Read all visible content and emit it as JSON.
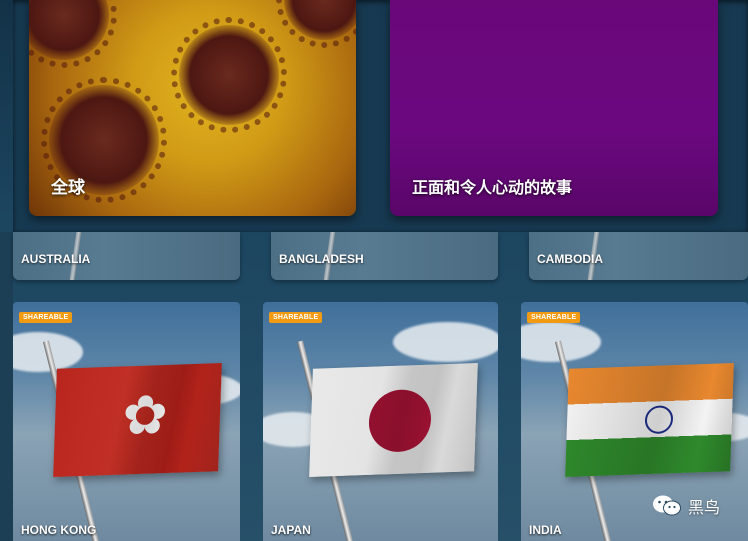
{
  "top_tiles": [
    {
      "label": "全球"
    },
    {
      "label": "正面和令人心动的故事"
    }
  ],
  "countries_row": [
    {
      "label": "AUSTRALIA"
    },
    {
      "label": "BANGLADESH"
    },
    {
      "label": "CAMBODIA"
    }
  ],
  "flag_tiles": [
    {
      "badge": "SHAREABLE",
      "label": "HONG KONG",
      "flag_icon": "hong-kong-flag"
    },
    {
      "badge": "SHAREABLE",
      "label": "JAPAN",
      "flag_icon": "japan-flag"
    },
    {
      "badge": "SHAREABLE",
      "label": "INDIA",
      "flag_icon": "india-flag"
    }
  ],
  "watermark": {
    "text": "黑鸟",
    "icon": "wechat-icon"
  },
  "colors": {
    "badge": "#f19a12",
    "stories_tile": "#6a087a",
    "background": "#1a3b52"
  }
}
